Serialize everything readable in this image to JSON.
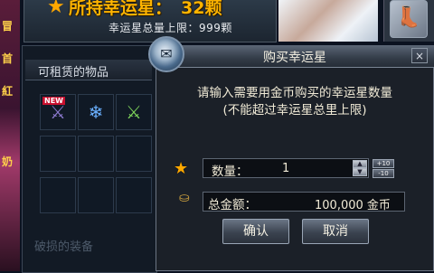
{
  "background": {
    "left_strip_chars": [
      "冒",
      "首",
      "紅",
      "奶"
    ],
    "owned_label": "所持幸运星",
    "owned_count": "32颗",
    "cap_text": "幸运星总量上限：999颗",
    "inventory": {
      "header": "可租赁的物品",
      "new_badge": "NEW",
      "slots": [
        {
          "icon": "weapon-item-icon",
          "glyph": "⚔"
        },
        {
          "icon": "crystal-item-icon",
          "glyph": "❄"
        },
        {
          "icon": "blade-item-icon",
          "glyph": "⚔"
        }
      ],
      "footer_text": "破损的装备"
    }
  },
  "dialog": {
    "title": "购买幸运星",
    "close_glyph": "×",
    "instruction_line1": "请输入需要用金币购买的幸运星数量",
    "instruction_line2": "(不能超过幸运星总里上限)",
    "quantity_label": "数量：",
    "quantity_value": "1",
    "plus10": "+10",
    "minus10": "-10",
    "total_label": "总金额：",
    "total_value": "100,000 金币",
    "confirm_label": "确认",
    "cancel_label": "取消"
  },
  "colors": {
    "gold": "#ffa800",
    "dialog_bg": "#1b2028",
    "accent_text": "#f0ead6"
  }
}
